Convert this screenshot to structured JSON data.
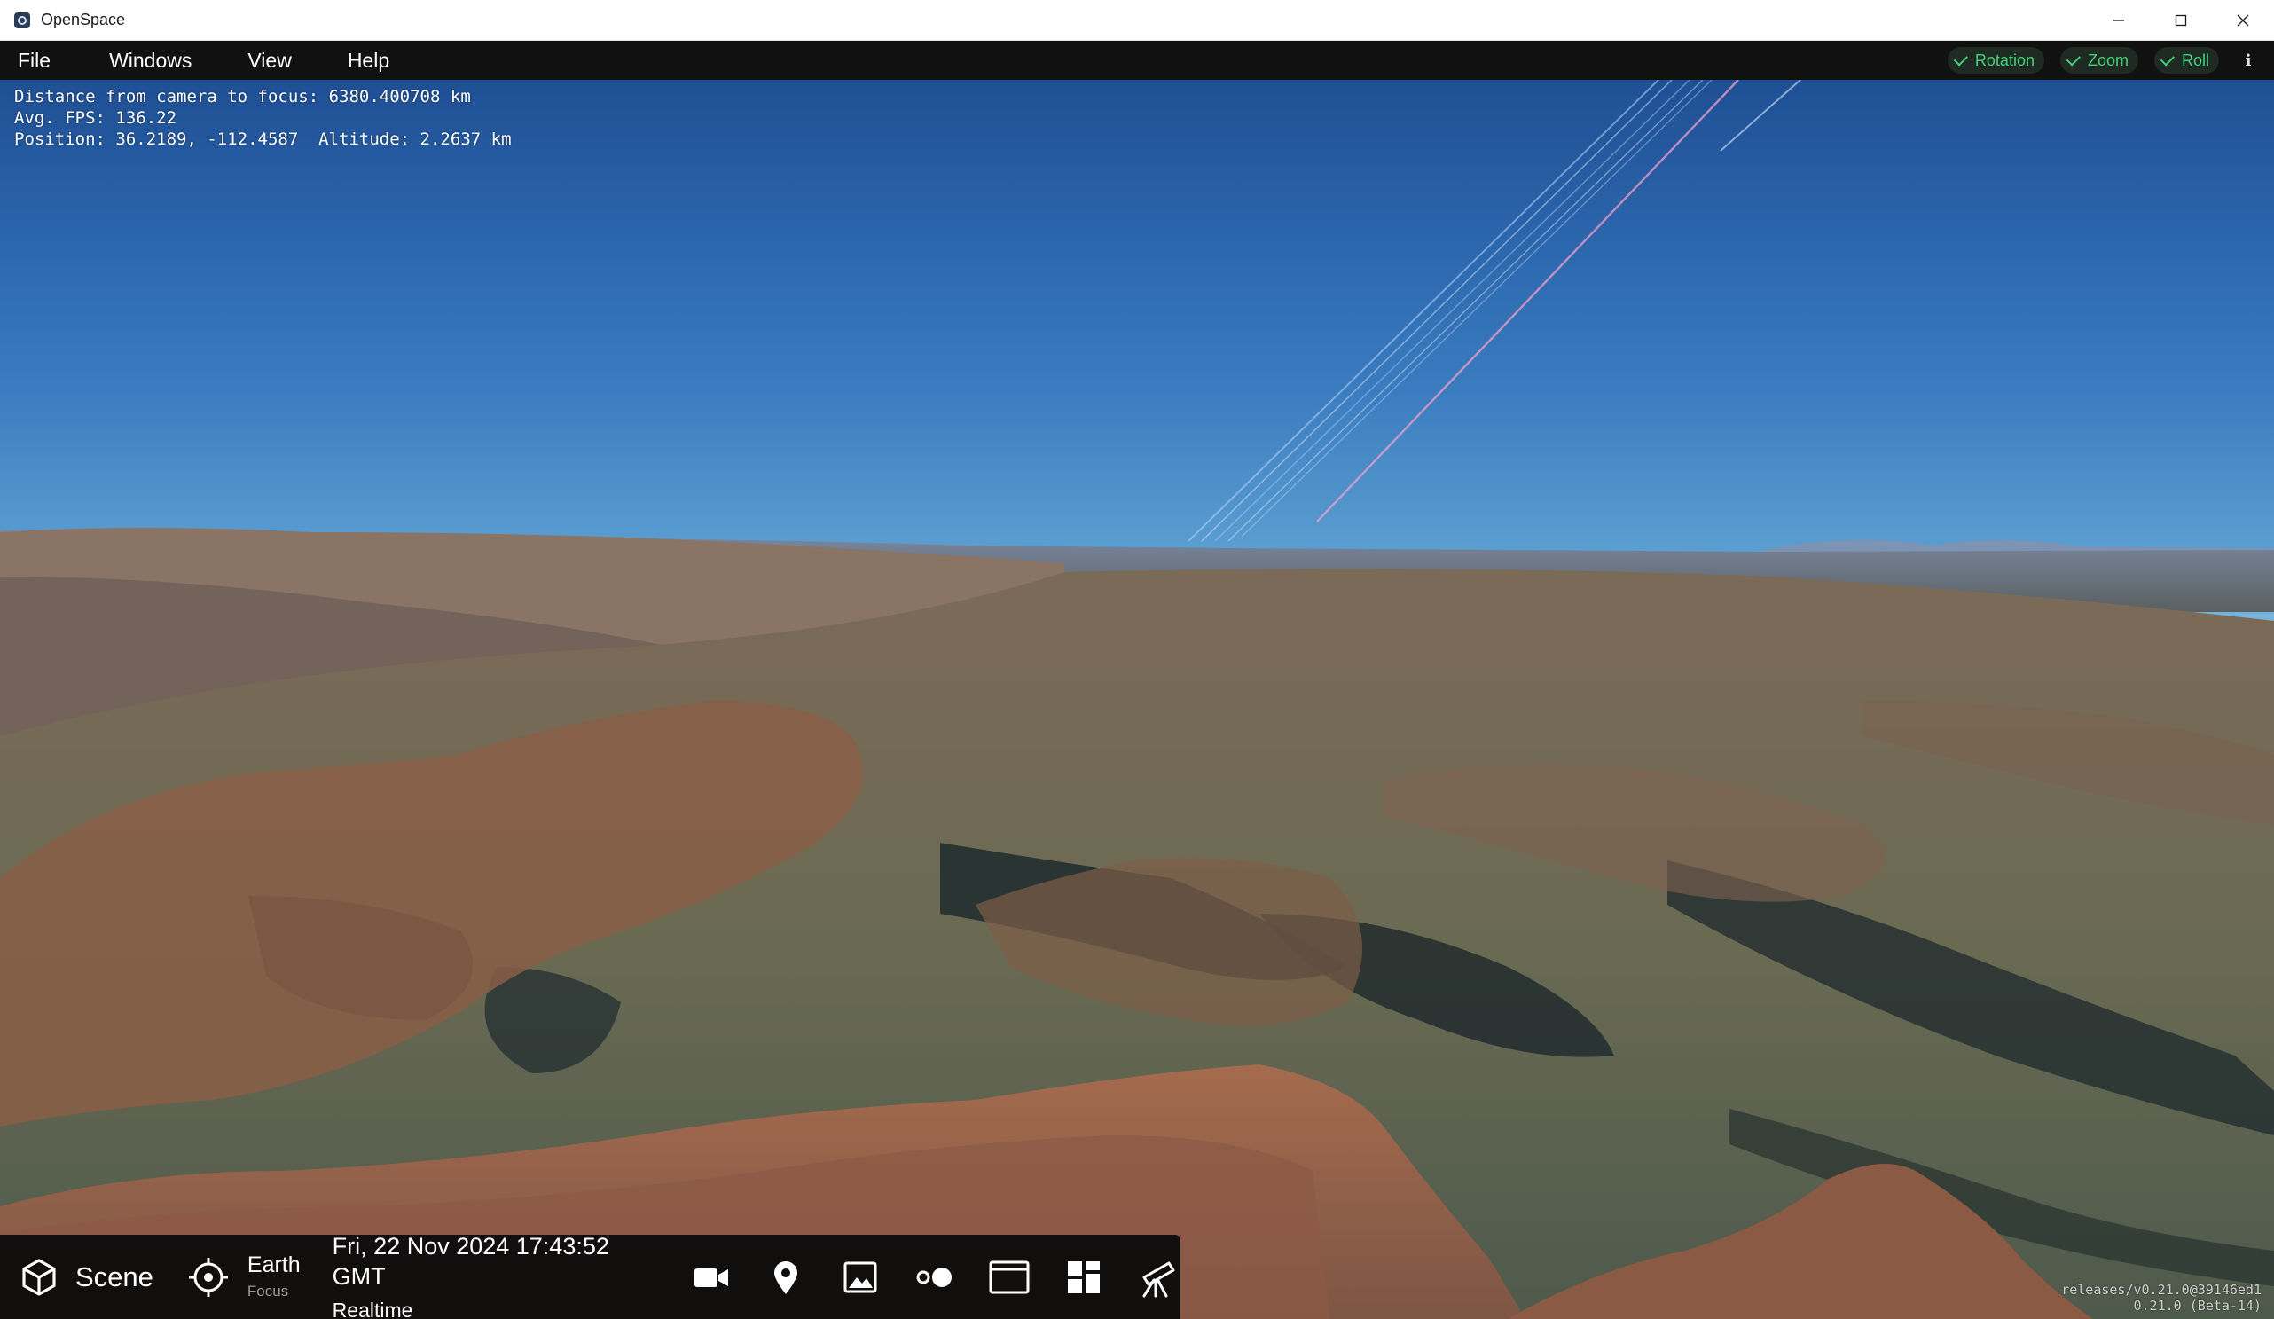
{
  "window": {
    "title": "OpenSpace",
    "controls": {
      "minimize": "—",
      "maximize": "☐",
      "close": "✕"
    }
  },
  "menubar": {
    "items": [
      "File",
      "Windows",
      "View",
      "Help"
    ],
    "toggles": [
      {
        "label": "Rotation",
        "checked": true
      },
      {
        "label": "Zoom",
        "checked": true
      },
      {
        "label": "Roll",
        "checked": true
      }
    ],
    "info_label": "i"
  },
  "hud": {
    "line1": "Distance from camera to focus: 6380.400708 km",
    "line2": "Avg. FPS: 136.22",
    "line3": "Position: 36.2189, -112.4587  Altitude: 2.2637 km"
  },
  "version": {
    "line1": "releases/v0.21.0@39146ed1",
    "line2": "0.21.0 (Beta-14)"
  },
  "taskbar": {
    "scene_label": "Scene",
    "focus_name": "Earth",
    "focus_sub": "Focus",
    "time_date": "Fri, 22 Nov 2024 17:43:52 GMT",
    "time_mode": "Realtime",
    "tools": [
      "camera-icon",
      "location-pin-icon",
      "image-icon",
      "two-dots-icon",
      "browser-window-icon",
      "dashboard-icon",
      "telescope-icon"
    ]
  },
  "colors": {
    "toggle_green": "#43d17a",
    "menubar_bg": "#111111",
    "sky_top": "#1f4f94",
    "sky_horizon": "#8fc3df"
  }
}
